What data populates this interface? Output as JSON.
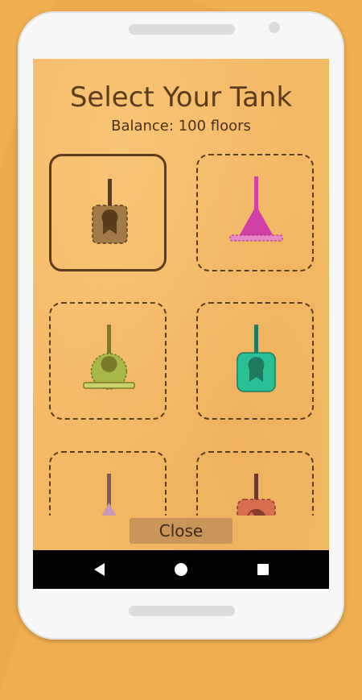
{
  "screen": {
    "title": "Select Your Tank",
    "balance": "Balance: 100 floors",
    "close_label": "Close"
  },
  "tanks": [
    {
      "icon": "brown-ribbon-tank-icon",
      "color": "#7a5630",
      "selected": true
    },
    {
      "icon": "pink-cone-tank-icon",
      "color": "#d23fa6",
      "selected": false
    },
    {
      "icon": "green-round-tank-icon",
      "color": "#a8b848",
      "selected": false
    },
    {
      "icon": "teal-ribbon-tank-icon",
      "color": "#2bbf95",
      "selected": false
    },
    {
      "icon": "lilac-cone-tank-icon",
      "color": "#c99ab8",
      "selected": false
    },
    {
      "icon": "red-radiation-tank-icon",
      "color": "#d96d52",
      "selected": false
    }
  ],
  "nav": {
    "back": "back-icon",
    "home": "home-icon",
    "recent": "recent-apps-icon"
  }
}
